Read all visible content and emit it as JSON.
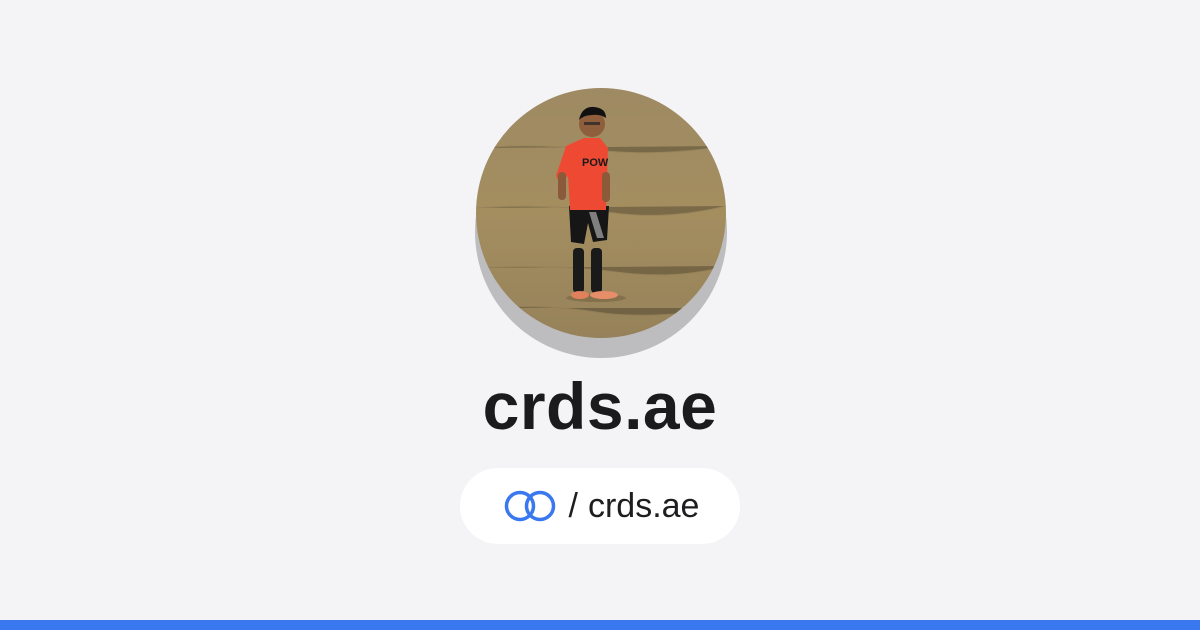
{
  "profile": {
    "avatar_description": "photo",
    "title": "crds.ae",
    "link_separator": "/",
    "link_handle": "crds.ae"
  },
  "icons": {
    "brand_logo": "chain-link-icon"
  },
  "colors": {
    "background": "#f4f4f6",
    "accent": "#3a78f0",
    "pill": "#ffffff",
    "text": "#1b1b1d"
  }
}
